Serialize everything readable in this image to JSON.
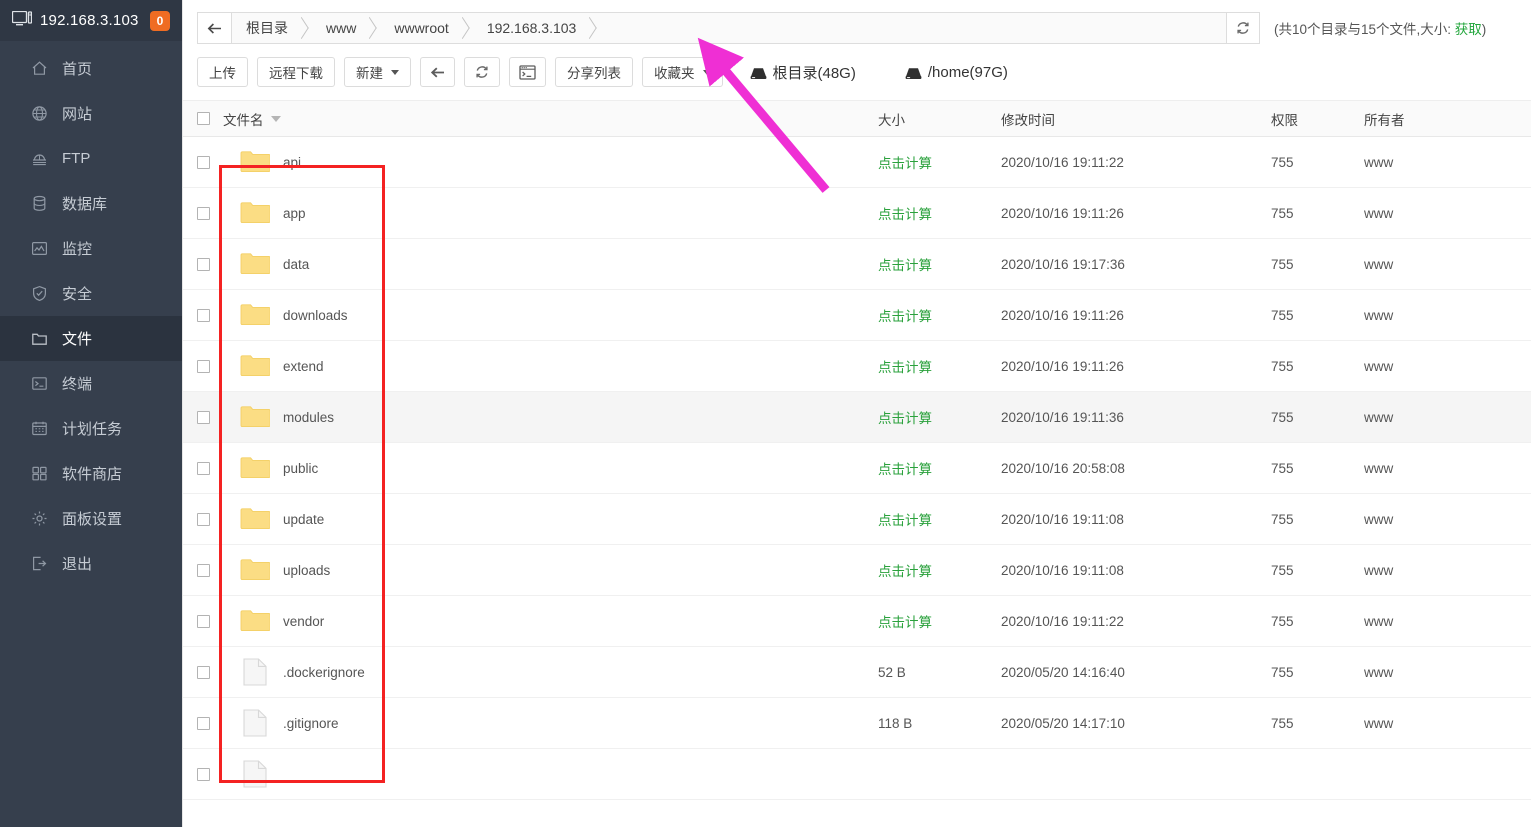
{
  "sidebar": {
    "header": {
      "title": "192.168.3.103",
      "badge": "0",
      "icon": "monitor-icon"
    },
    "items": [
      {
        "label": "首页",
        "icon": "home-icon",
        "active": false
      },
      {
        "label": "网站",
        "icon": "globe-icon",
        "active": false
      },
      {
        "label": "FTP",
        "icon": "ftp-icon",
        "active": false
      },
      {
        "label": "数据库",
        "icon": "database-icon",
        "active": false
      },
      {
        "label": "监控",
        "icon": "chart-icon",
        "active": false
      },
      {
        "label": "安全",
        "icon": "shield-icon",
        "active": false
      },
      {
        "label": "文件",
        "icon": "folder-icon",
        "active": true
      },
      {
        "label": "终端",
        "icon": "terminal-icon",
        "active": false
      },
      {
        "label": "计划任务",
        "icon": "calendar-icon",
        "active": false
      },
      {
        "label": "软件商店",
        "icon": "grid-icon",
        "active": false
      },
      {
        "label": "面板设置",
        "icon": "gear-icon",
        "active": false
      },
      {
        "label": "退出",
        "icon": "logout-icon",
        "active": false
      }
    ]
  },
  "breadcrumb": {
    "back_icon": "arrow-left-icon",
    "items": [
      "根目录",
      "www",
      "wwwroot",
      "192.168.3.103"
    ],
    "refresh_icon": "refresh-icon",
    "stat_prefix": "(共10个目录与15个文件,大小: ",
    "stat_link": "获取",
    "stat_suffix": ")"
  },
  "toolbar": {
    "upload": "上传",
    "remote_download": "远程下载",
    "new": "新建",
    "back_icon": "arrow-left-icon",
    "refresh_icon": "refresh-icon",
    "terminal_icon": "terminal-icon",
    "share_list": "分享列表",
    "favorites": "收藏夹",
    "disk_root": "根目录(48G)",
    "disk_home": "/home(97G)"
  },
  "table": {
    "headers": {
      "name": "文件名",
      "size": "大小",
      "time": "修改时间",
      "perm": "权限",
      "owner": "所有者"
    },
    "rows": [
      {
        "name": "api",
        "type": "folder",
        "size": "点击计算",
        "size_is_link": true,
        "time": "2020/10/16 19:11:22",
        "perm": "755",
        "owner": "www",
        "hover": false
      },
      {
        "name": "app",
        "type": "folder",
        "size": "点击计算",
        "size_is_link": true,
        "time": "2020/10/16 19:11:26",
        "perm": "755",
        "owner": "www",
        "hover": false
      },
      {
        "name": "data",
        "type": "folder",
        "size": "点击计算",
        "size_is_link": true,
        "time": "2020/10/16 19:17:36",
        "perm": "755",
        "owner": "www",
        "hover": false
      },
      {
        "name": "downloads",
        "type": "folder",
        "size": "点击计算",
        "size_is_link": true,
        "time": "2020/10/16 19:11:26",
        "perm": "755",
        "owner": "www",
        "hover": false
      },
      {
        "name": "extend",
        "type": "folder",
        "size": "点击计算",
        "size_is_link": true,
        "time": "2020/10/16 19:11:26",
        "perm": "755",
        "owner": "www",
        "hover": false
      },
      {
        "name": "modules",
        "type": "folder",
        "size": "点击计算",
        "size_is_link": true,
        "time": "2020/10/16 19:11:36",
        "perm": "755",
        "owner": "www",
        "hover": true
      },
      {
        "name": "public",
        "type": "folder",
        "size": "点击计算",
        "size_is_link": true,
        "time": "2020/10/16 20:58:08",
        "perm": "755",
        "owner": "www",
        "hover": false
      },
      {
        "name": "update",
        "type": "folder",
        "size": "点击计算",
        "size_is_link": true,
        "time": "2020/10/16 19:11:08",
        "perm": "755",
        "owner": "www",
        "hover": false
      },
      {
        "name": "uploads",
        "type": "folder",
        "size": "点击计算",
        "size_is_link": true,
        "time": "2020/10/16 19:11:08",
        "perm": "755",
        "owner": "www",
        "hover": false
      },
      {
        "name": "vendor",
        "type": "folder",
        "size": "点击计算",
        "size_is_link": true,
        "time": "2020/10/16 19:11:22",
        "perm": "755",
        "owner": "www",
        "hover": false
      },
      {
        "name": ".dockerignore",
        "type": "file",
        "size": "52 B",
        "size_is_link": false,
        "time": "2020/05/20 14:16:40",
        "perm": "755",
        "owner": "www",
        "hover": false
      },
      {
        "name": ".gitignore",
        "type": "file",
        "size": "118 B",
        "size_is_link": false,
        "time": "2020/05/20 14:17:10",
        "perm": "755",
        "owner": "www",
        "hover": false
      },
      {
        "name": "",
        "type": "file",
        "size": "",
        "size_is_link": false,
        "time": "",
        "perm": "",
        "owner": "",
        "hover": false
      }
    ]
  },
  "annotations": {
    "highlight_box_color": "#f42222",
    "arrow_color": "#ef2fd4"
  }
}
